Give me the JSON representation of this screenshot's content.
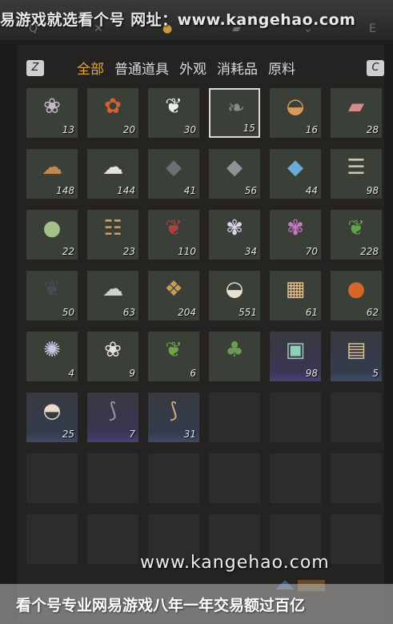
{
  "watermark_top": "易游戏就选看个号  网址：www.kangehao.com",
  "watermark_bottom": "看个号专业网易游戏八年一年交易额过百亿",
  "watermark_url": "www.kangehao.com",
  "top_icons": [
    "Q",
    "✕",
    "●",
    "▰",
    "⌄",
    "E"
  ],
  "keycaps": {
    "left": "Z",
    "right": "C"
  },
  "tabs": [
    {
      "label": "全部",
      "active": true
    },
    {
      "label": "普通道具",
      "active": false
    },
    {
      "label": "外观",
      "active": false
    },
    {
      "label": "消耗品",
      "active": false
    },
    {
      "label": "原料",
      "active": false
    }
  ],
  "items": [
    {
      "icon": "flower-sprig-icon",
      "glyph": "❀",
      "color": "#c9b7c9",
      "count": "13"
    },
    {
      "icon": "red-flower-icon",
      "glyph": "✿",
      "color": "#d8602a",
      "count": "20"
    },
    {
      "icon": "white-feather-icon",
      "glyph": "❦",
      "color": "#ececec",
      "count": "30"
    },
    {
      "icon": "dark-herb-icon",
      "glyph": "❧",
      "color": "#8a8a8a",
      "count": "15",
      "selected": true
    },
    {
      "icon": "soup-bowl-icon",
      "glyph": "◒",
      "color": "#d79a5c",
      "count": "16"
    },
    {
      "icon": "raw-meat-icon",
      "glyph": "▰",
      "color": "#d98a86",
      "count": "28"
    },
    {
      "icon": "fur-pelt-icon",
      "glyph": "☁",
      "color": "#c08852",
      "count": "148"
    },
    {
      "icon": "white-fleece-icon",
      "glyph": "☁",
      "color": "#e5e2dc",
      "count": "144"
    },
    {
      "icon": "dark-ore-icon",
      "glyph": "◆",
      "color": "#6b6e73",
      "count": "41"
    },
    {
      "icon": "iron-ore-icon",
      "glyph": "◆",
      "color": "#8e949c",
      "count": "56"
    },
    {
      "icon": "blue-crystal-icon",
      "glyph": "◆",
      "color": "#6ea9d8",
      "count": "44"
    },
    {
      "icon": "bone-spine-icon",
      "glyph": "☰",
      "color": "#cfc6b4",
      "count": "98"
    },
    {
      "icon": "green-gourd-icon",
      "glyph": "●",
      "color": "#a5c08a",
      "count": "22"
    },
    {
      "icon": "grain-sacks-icon",
      "glyph": "☷",
      "color": "#c8a070",
      "count": "23"
    },
    {
      "icon": "red-berry-branch-icon",
      "glyph": "❦",
      "color": "#b04040",
      "count": "110"
    },
    {
      "icon": "white-flower-plant-icon",
      "glyph": "✾",
      "color": "#d6d2ea",
      "count": "34"
    },
    {
      "icon": "purple-flower-plant-icon",
      "glyph": "✾",
      "color": "#c27ac2",
      "count": "70"
    },
    {
      "icon": "green-herb-icon",
      "glyph": "❦",
      "color": "#5fa24a",
      "count": "228"
    },
    {
      "icon": "black-feather-icon",
      "glyph": "❦",
      "color": "#4a4a52",
      "count": "50"
    },
    {
      "icon": "black-white-tuft-icon",
      "glyph": "☁",
      "color": "#d0d0d0",
      "count": "63"
    },
    {
      "icon": "tree-bark-icon",
      "glyph": "❖",
      "color": "#c79b5a",
      "count": "204"
    },
    {
      "icon": "rice-bowl-icon",
      "glyph": "◒",
      "color": "#e8e0d0",
      "count": "551"
    },
    {
      "icon": "tofu-cubes-icon",
      "glyph": "▦",
      "color": "#e6c28a",
      "count": "61"
    },
    {
      "icon": "orange-fruit-icon",
      "glyph": "●",
      "color": "#d8652a",
      "count": "62"
    },
    {
      "icon": "spider-lily-icon",
      "glyph": "✺",
      "color": "#c8c8e6",
      "count": "4"
    },
    {
      "icon": "white-rose-plant-icon",
      "glyph": "❀",
      "color": "#e8e2dc",
      "count": "9"
    },
    {
      "icon": "orange-blossom-herb-icon",
      "glyph": "❦",
      "color": "#6ea248",
      "count": "6"
    },
    {
      "icon": "bonsai-pot-icon",
      "glyph": "♣",
      "color": "#6a9a5a",
      "count": ""
    },
    {
      "icon": "gift-box-icon",
      "glyph": "▣",
      "color": "#8fd0b8",
      "count": "98",
      "rarity": "purple"
    },
    {
      "icon": "scroll-icon",
      "glyph": "▤",
      "color": "#d8c29a",
      "count": "5",
      "rarity": "blue"
    },
    {
      "icon": "porcelain-jar-icon",
      "glyph": "◓",
      "color": "#e6dcc8",
      "count": "25",
      "rarity": "blue"
    },
    {
      "icon": "purple-horn-icon",
      "glyph": "⟆",
      "color": "#9a90a8",
      "count": "7",
      "rarity": "purple"
    },
    {
      "icon": "ivory-horn-icon",
      "glyph": "⟆",
      "color": "#c8a880",
      "count": "31",
      "rarity": "blue"
    }
  ],
  "empty_slots": 15
}
